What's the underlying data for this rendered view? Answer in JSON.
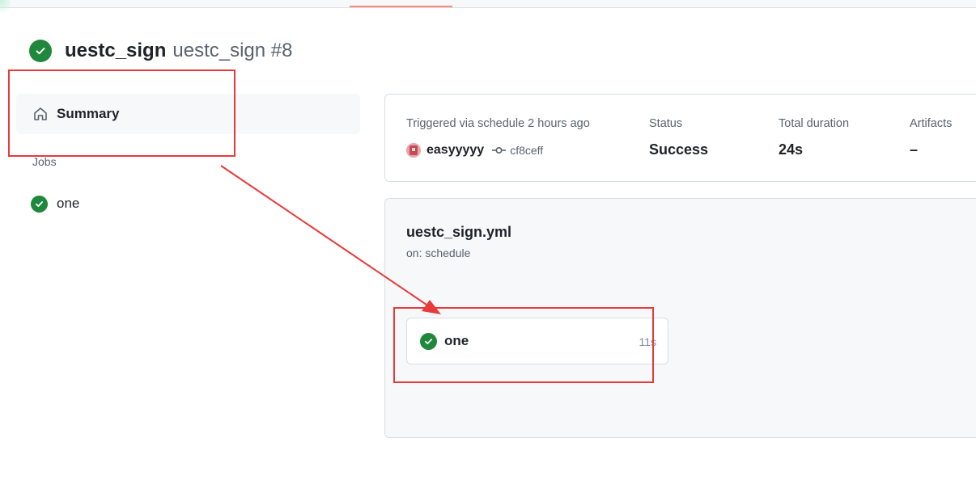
{
  "run": {
    "workflow_name": "uestc_sign",
    "run_label": "uestc_sign #8",
    "status_icon": "check-circle-fill-icon"
  },
  "sidebar": {
    "summary_label": "Summary",
    "summary_icon": "home-icon",
    "jobs_heading": "Jobs",
    "jobs": [
      {
        "label": "one",
        "status_icon": "check-circle-fill-icon"
      }
    ]
  },
  "summary_card": {
    "trigger_text": "Triggered via schedule 2 hours ago",
    "actor": "easyyyyy",
    "commit_sha": "cf8ceff",
    "status_label": "Status",
    "status_value": "Success",
    "duration_label": "Total duration",
    "duration_value": "24s",
    "artifacts_label": "Artifacts",
    "artifacts_value": "–"
  },
  "workflow_graph": {
    "file_name": "uestc_sign.yml",
    "trigger": "on: schedule",
    "jobs": [
      {
        "name": "one",
        "duration": "11s",
        "status_icon": "check-circle-fill-icon"
      }
    ]
  },
  "colors": {
    "success": "#1f883d",
    "annotation": "#e83a3a",
    "tab_underline": "#fd8c73"
  }
}
